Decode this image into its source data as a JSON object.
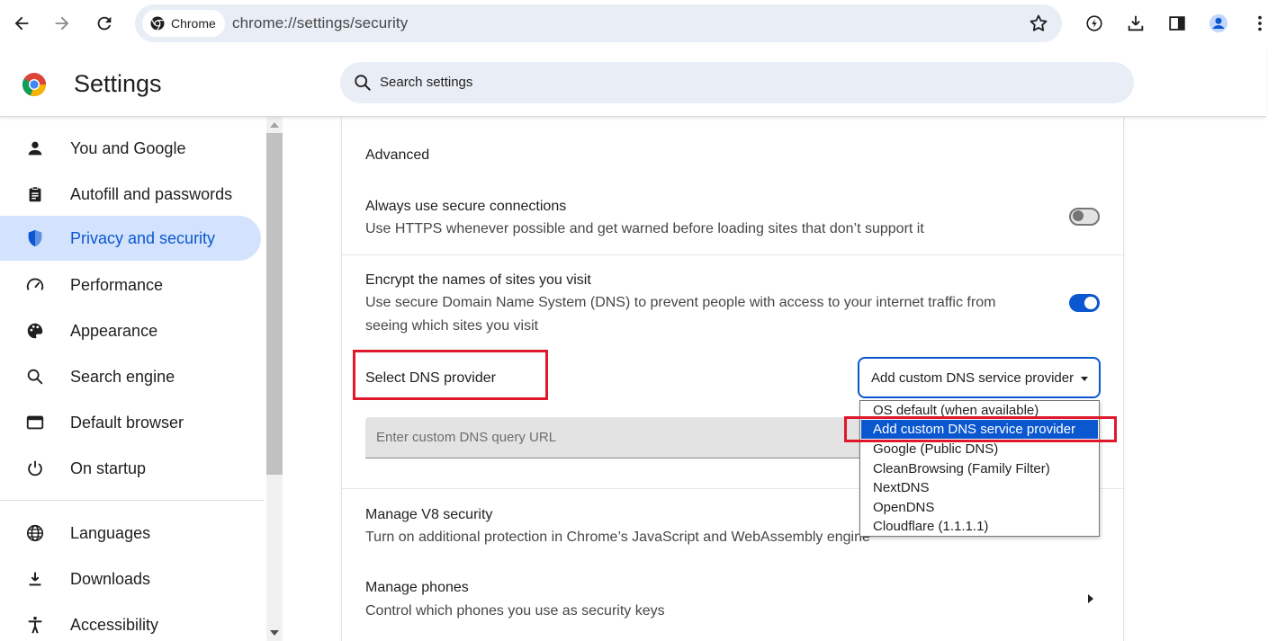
{
  "browser": {
    "chip_label": "Chrome",
    "url": "chrome://settings/security"
  },
  "header": {
    "title": "Settings",
    "search_placeholder": "Search settings"
  },
  "sidebar": {
    "items": [
      {
        "label": "You and Google",
        "icon": "person-icon"
      },
      {
        "label": "Autofill and passwords",
        "icon": "clipboard-icon"
      },
      {
        "label": "Privacy and security",
        "icon": "shield-icon",
        "active": true
      },
      {
        "label": "Performance",
        "icon": "speedometer-icon"
      },
      {
        "label": "Appearance",
        "icon": "palette-icon"
      },
      {
        "label": "Search engine",
        "icon": "search-icon"
      },
      {
        "label": "Default browser",
        "icon": "browser-window-icon"
      },
      {
        "label": "On startup",
        "icon": "power-icon"
      },
      {
        "label": "Languages",
        "icon": "globe-icon"
      },
      {
        "label": "Downloads",
        "icon": "download-icon"
      },
      {
        "label": "Accessibility",
        "icon": "accessibility-icon"
      }
    ]
  },
  "main": {
    "section_title": "Advanced",
    "secure_connections": {
      "title": "Always use secure connections",
      "subtitle": "Use HTTPS whenever possible and get warned before loading sites that don’t support it",
      "enabled": false
    },
    "secure_dns": {
      "title": "Encrypt the names of sites you visit",
      "subtitle_line1": "Use secure Domain Name System (DNS) to prevent people with access to your internet traffic from",
      "subtitle_line2": "seeing which sites you visit",
      "enabled": true
    },
    "dns_provider": {
      "label": "Select DNS provider",
      "selected": "Add custom DNS service provider",
      "custom_url_placeholder": "Enter custom DNS query URL",
      "options": [
        "OS default (when available)",
        "Add custom DNS service provider",
        "Google (Public DNS)",
        "CleanBrowsing (Family Filter)",
        "NextDNS",
        "OpenDNS",
        "Cloudflare (1.1.1.1)"
      ]
    },
    "v8": {
      "title": "Manage V8 security",
      "subtitle": "Turn on additional protection in Chrome’s JavaScript and WebAssembly engine"
    },
    "phones": {
      "title": "Manage phones",
      "subtitle": "Control which phones you use as security keys"
    }
  },
  "colors": {
    "accent": "#0b57d0",
    "highlight_box": "#e0182b",
    "active_nav_bg": "#d3e3fd"
  }
}
